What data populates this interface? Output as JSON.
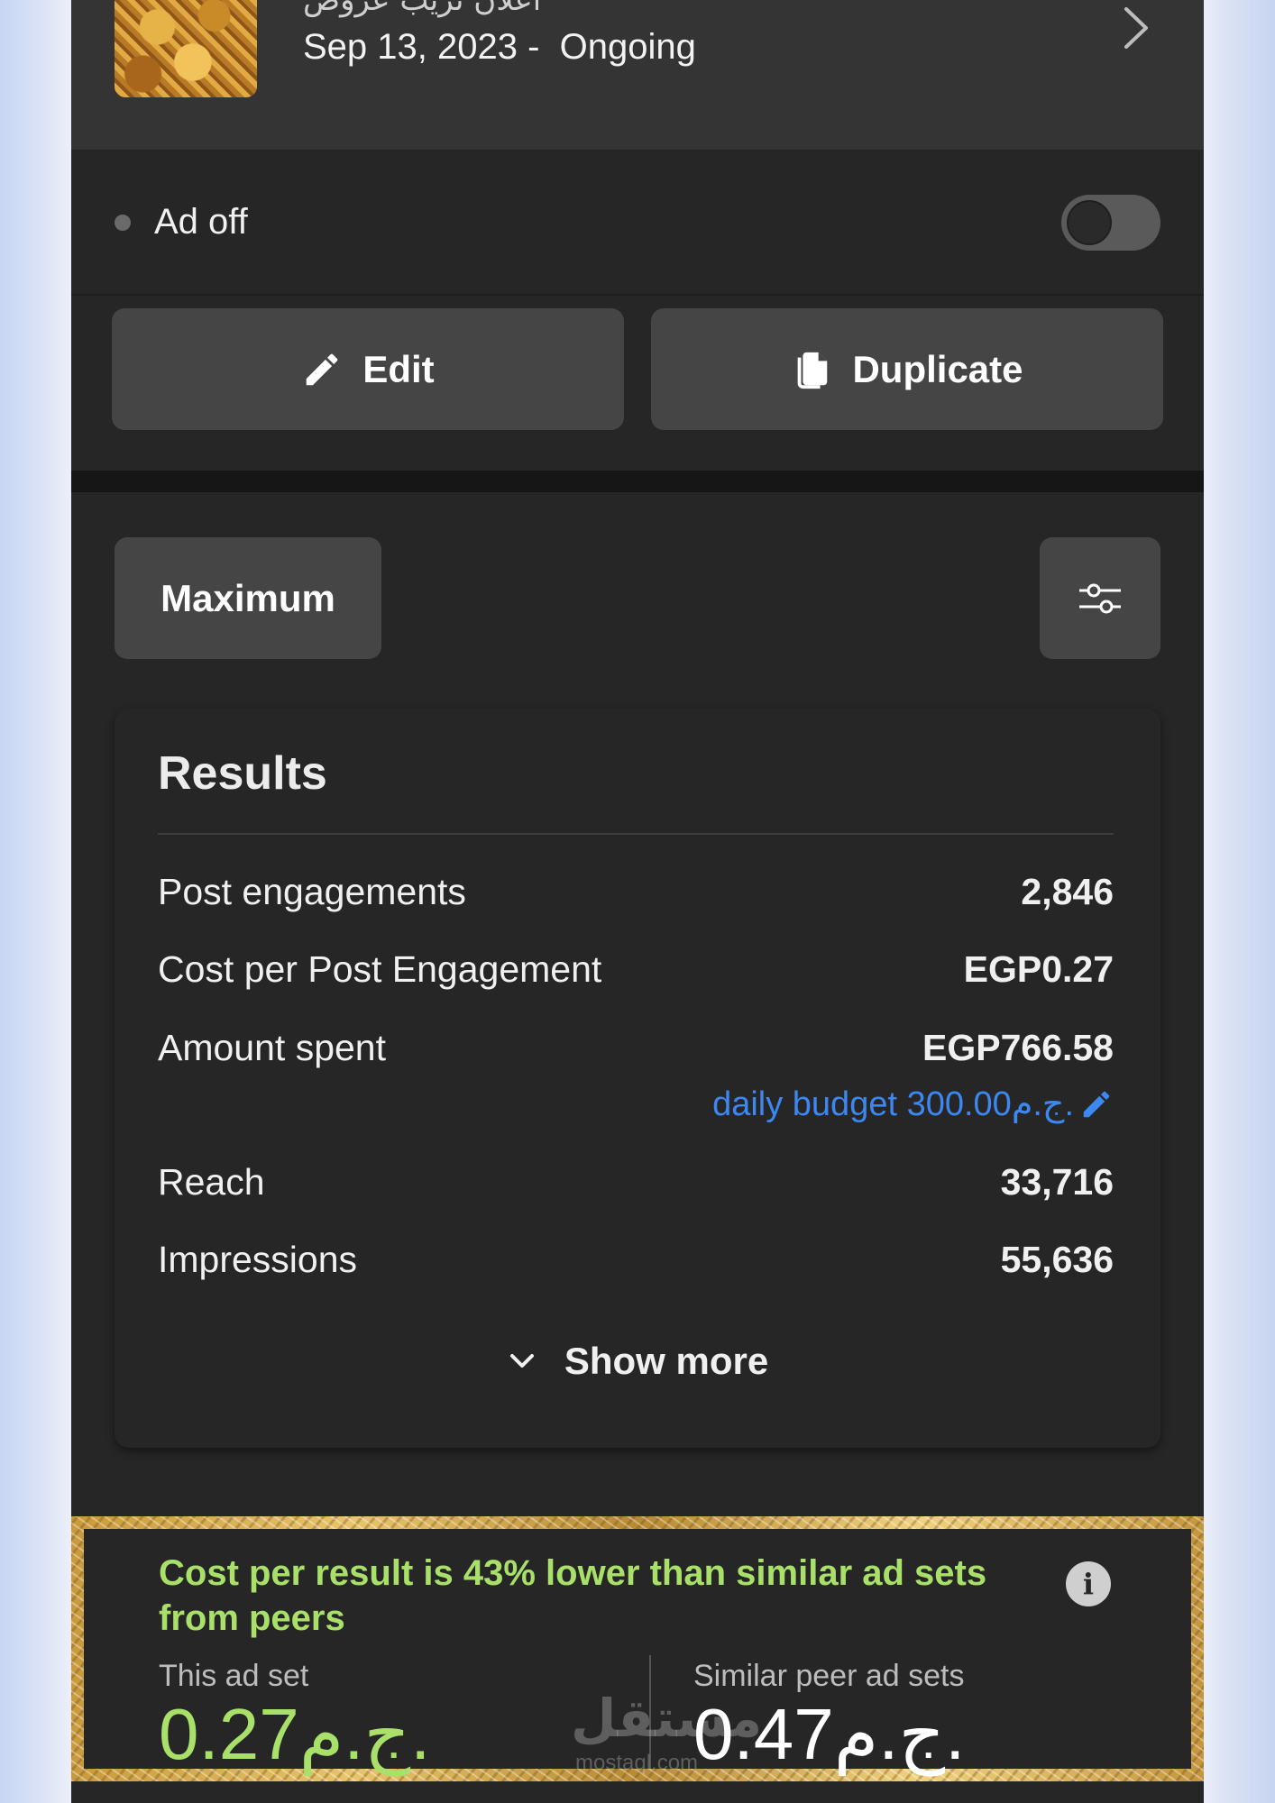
{
  "header": {
    "ad_title": "اعلان تريب عروض",
    "date_status": "Sep 13, 2023 -  Ongoing"
  },
  "status": {
    "label": "Ad off",
    "toggle_on": false
  },
  "actions": {
    "edit_label": "Edit",
    "duplicate_label": "Duplicate"
  },
  "filters": {
    "range_label": "Maximum"
  },
  "results": {
    "title": "Results",
    "rows": [
      {
        "label": "Post engagements",
        "value": "2,846"
      },
      {
        "label": "Cost per Post Engagement",
        "value": "EGP0.27"
      },
      {
        "label": "Amount spent",
        "value": "EGP766.58"
      },
      {
        "label": "Reach",
        "value": "33,716"
      },
      {
        "label": "Impressions",
        "value": "55,636"
      }
    ],
    "daily_budget": "daily budget 300.00ج.م.",
    "show_more": "Show more"
  },
  "comparison": {
    "headline": "Cost per result is 43% lower than similar ad sets from peers",
    "this_label": "This ad set",
    "this_value": "0.27ج.م.",
    "peer_label": "Similar peer ad sets",
    "peer_value": "0.47ج.م.",
    "positive_color": "#a8e06a"
  },
  "watermark": {
    "text": "مستقل",
    "sub": "mostaql.com"
  },
  "colors": {
    "background": "#262626",
    "surface": "#343434",
    "button": "#454545",
    "link": "#3d87f0"
  }
}
